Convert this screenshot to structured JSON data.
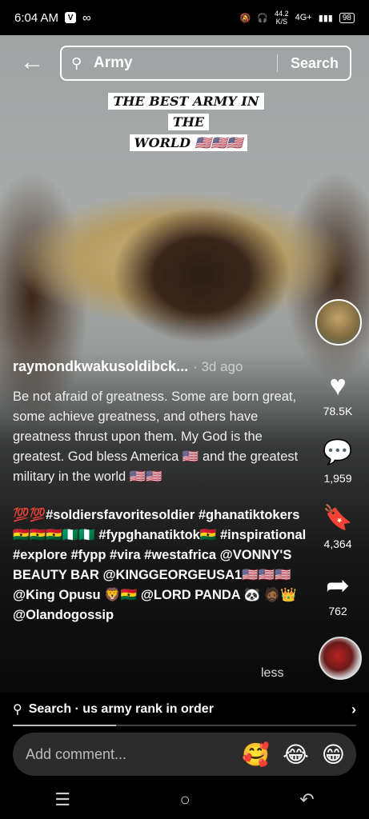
{
  "status": {
    "time": "6:04 AM",
    "speed": "44.2",
    "speed_unit": "K/S",
    "network": "4G+",
    "battery": "98"
  },
  "search": {
    "query": "Army",
    "button": "Search"
  },
  "banner": {
    "line1": "THE BEST ARMY IN THE",
    "line2": "WORLD 🇺🇸🇺🇸🇺🇸"
  },
  "post": {
    "username": "raymondkwakusoldibck...",
    "age": "· 3d ago",
    "caption": "Be not afraid of greatness. Some are born great, some achieve greatness, and others have greatness thrust upon them. My God is the greatest. God bless America 🇺🇸 and the greatest military in the world 🇺🇸🇺🇸",
    "tags": "💯💯#soldiersfavoritesoldier #ghanatiktokers🇬🇭🇬🇭🇬🇭🇳🇬🇳🇬 #fypghanatiktok🇬🇭 #inspirational #explore #fypp #vira #westafrica @VONNY'S BEAUTY BAR @KINGGEORGEUSA1🇺🇸🇺🇸🇺🇸 @King Opusu 🦁🇬🇭 @LORD PANDA 🐼 🧔🏾👑 @Olandogossip",
    "less": "less"
  },
  "actions": {
    "likes": "78.5K",
    "comments": "1,959",
    "saves": "4,364",
    "shares": "762"
  },
  "suggestion": {
    "label": "Search · us army rank in order"
  },
  "comment": {
    "placeholder": "Add comment...",
    "emojis": [
      "🥰",
      "😂",
      "😁"
    ]
  },
  "playback_progress": 0.3
}
